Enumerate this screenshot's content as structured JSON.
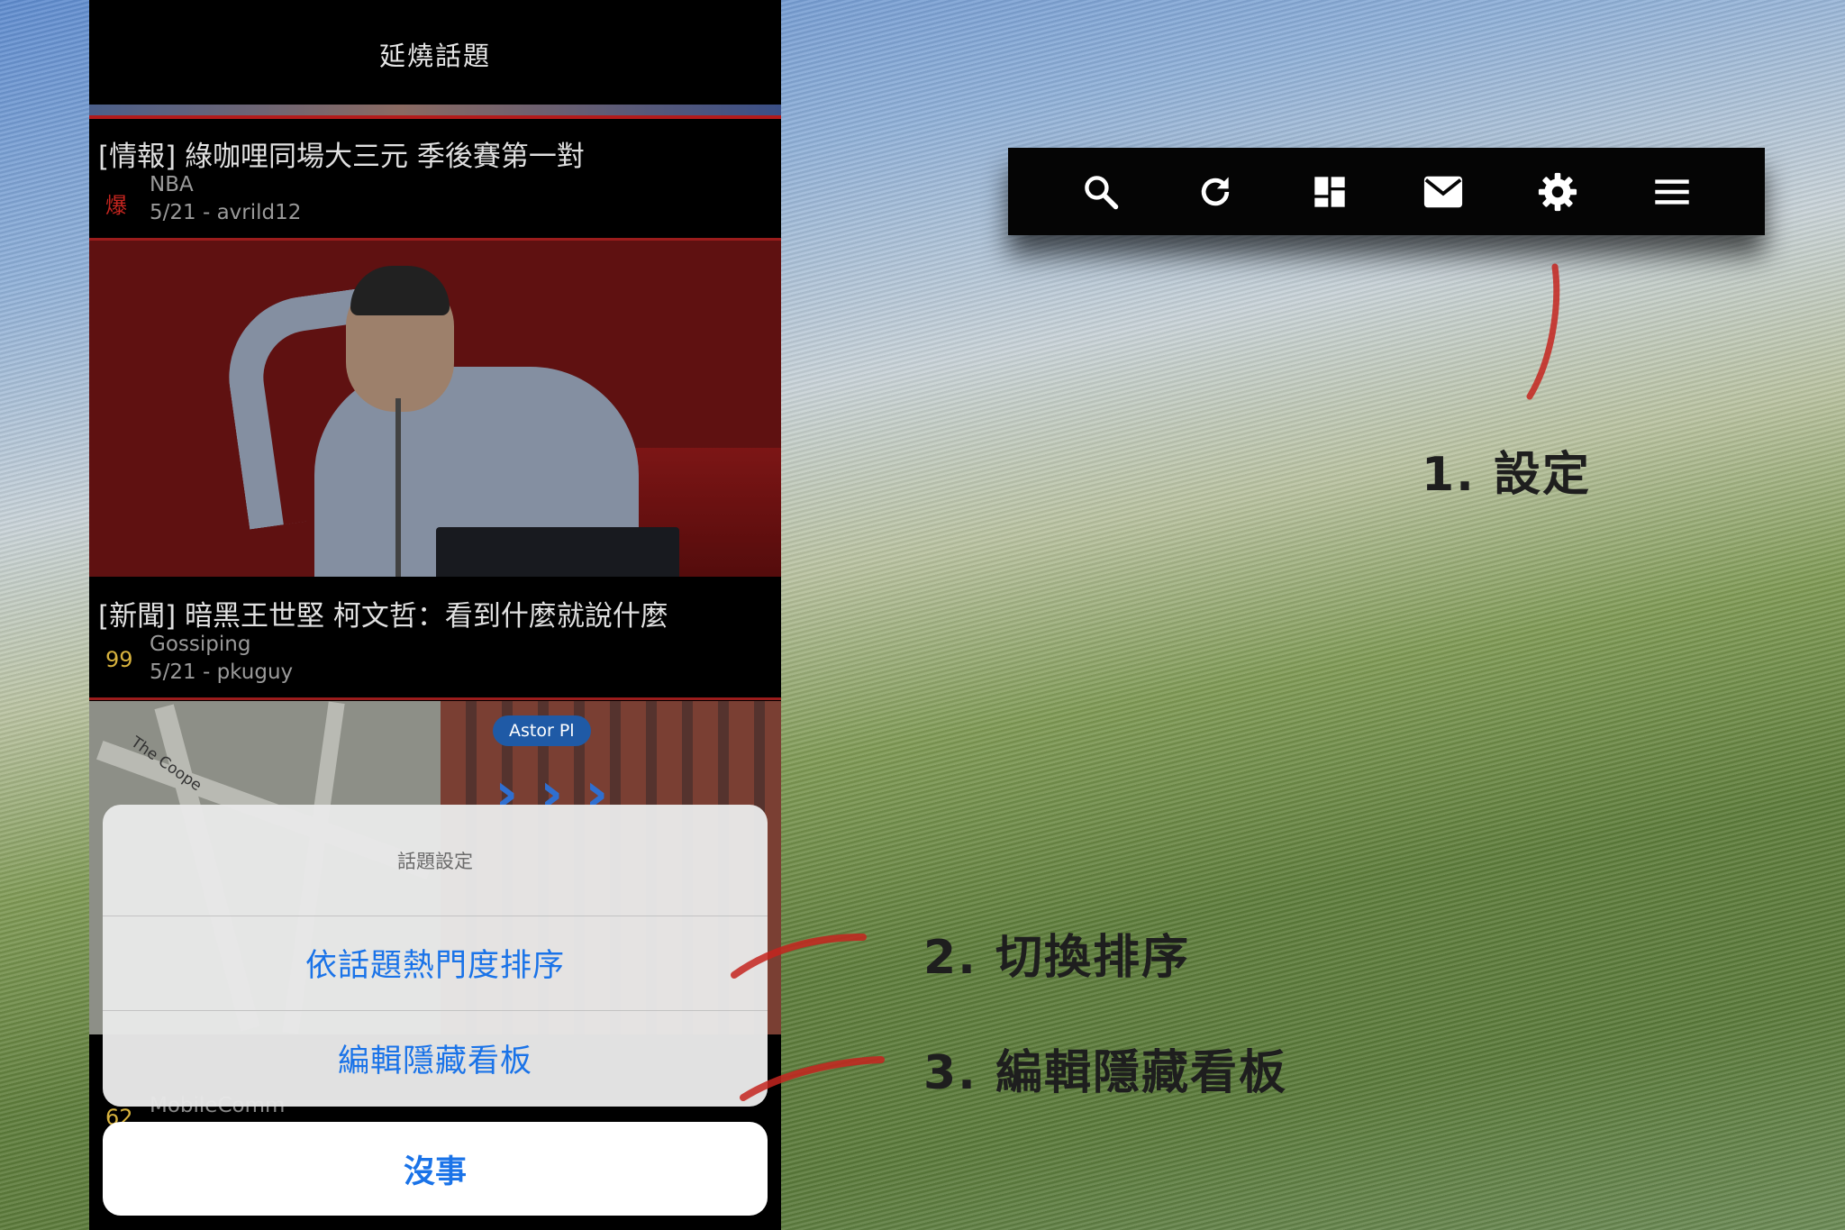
{
  "phone": {
    "nav_title": "延燒話題",
    "posts": [
      {
        "title": "[情報] 綠咖哩同場大三元 季後賽第一對",
        "score": "爆",
        "score_color": "#c4251f",
        "board": "NBA",
        "meta": "5/21 - avrild12"
      },
      {
        "title": "[新聞] 暗黑王世堅 柯文哲：看到什麼就說什麼",
        "score": "99",
        "score_color": "#d7b23e",
        "board": "Gossiping",
        "meta": "5/21 - pkuguy"
      }
    ],
    "map_label": "Astor Pl",
    "map_street": "The Coope",
    "hidden_post": {
      "score": "62",
      "board": "MobileComm"
    }
  },
  "sheet": {
    "title": "話題設定",
    "actions": [
      "依話題熱門度排序",
      "編輯隱藏看板"
    ],
    "cancel": "沒事"
  },
  "toolbar": {
    "icons": [
      "search-icon",
      "refresh-icon",
      "dashboard-icon",
      "mail-icon",
      "gear-icon",
      "menu-icon"
    ]
  },
  "annotations": [
    {
      "label": "1. 設定"
    },
    {
      "label": "2. 切換排序"
    },
    {
      "label": "3. 編輯隱藏看板"
    }
  ],
  "colors": {
    "accent_blue": "#1a73e8",
    "annotation_red": "#c4251f"
  }
}
